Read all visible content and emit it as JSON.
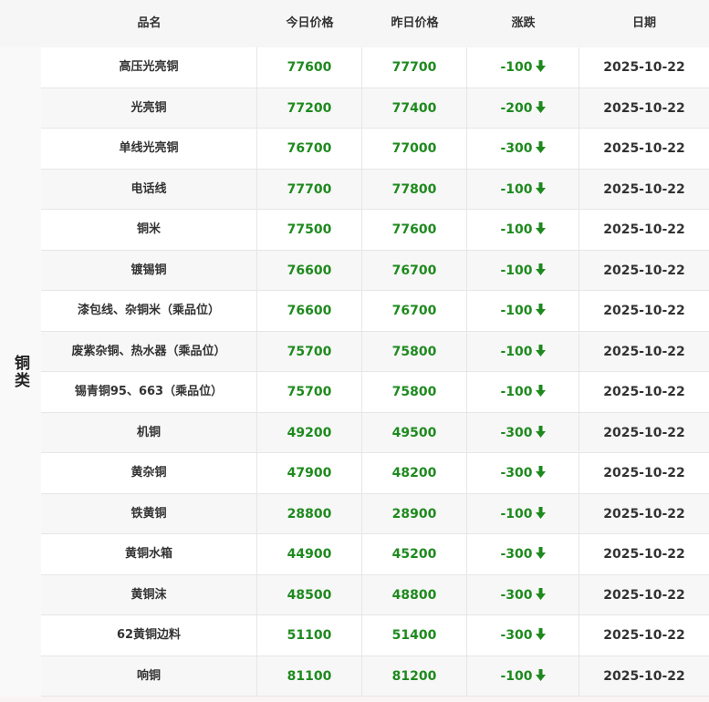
{
  "header": {
    "name": "品名",
    "today": "今日价格",
    "yesterday": "昨日价格",
    "change": "涨跌",
    "date": "日期"
  },
  "category": "铜类",
  "colors": {
    "green": "#1e8a1e"
  },
  "rows": [
    {
      "name": "高压光亮铜",
      "today": "77600",
      "yesterday": "77700",
      "change": "-100",
      "date": "2025-10-22"
    },
    {
      "name": "光亮铜",
      "today": "77200",
      "yesterday": "77400",
      "change": "-200",
      "date": "2025-10-22"
    },
    {
      "name": "单线光亮铜",
      "today": "76700",
      "yesterday": "77000",
      "change": "-300",
      "date": "2025-10-22"
    },
    {
      "name": "电话线",
      "today": "77700",
      "yesterday": "77800",
      "change": "-100",
      "date": "2025-10-22"
    },
    {
      "name": "铜米",
      "today": "77500",
      "yesterday": "77600",
      "change": "-100",
      "date": "2025-10-22"
    },
    {
      "name": "镀锡铜",
      "today": "76600",
      "yesterday": "76700",
      "change": "-100",
      "date": "2025-10-22"
    },
    {
      "name": "漆包线、杂铜米（乘品位）",
      "today": "76600",
      "yesterday": "76700",
      "change": "-100",
      "date": "2025-10-22"
    },
    {
      "name": "废紫杂铜、热水器（乘品位）",
      "today": "75700",
      "yesterday": "75800",
      "change": "-100",
      "date": "2025-10-22"
    },
    {
      "name": "锡青铜95、663（乘品位）",
      "today": "75700",
      "yesterday": "75800",
      "change": "-100",
      "date": "2025-10-22"
    },
    {
      "name": "机铜",
      "today": "49200",
      "yesterday": "49500",
      "change": "-300",
      "date": "2025-10-22"
    },
    {
      "name": "黄杂铜",
      "today": "47900",
      "yesterday": "48200",
      "change": "-300",
      "date": "2025-10-22"
    },
    {
      "name": "铁黄铜",
      "today": "28800",
      "yesterday": "28900",
      "change": "-100",
      "date": "2025-10-22"
    },
    {
      "name": "黄铜水箱",
      "today": "44900",
      "yesterday": "45200",
      "change": "-300",
      "date": "2025-10-22"
    },
    {
      "name": "黄铜沫",
      "today": "48500",
      "yesterday": "48800",
      "change": "-300",
      "date": "2025-10-22"
    },
    {
      "name": "62黄铜边料",
      "today": "51100",
      "yesterday": "51400",
      "change": "-300",
      "date": "2025-10-22"
    },
    {
      "name": "响铜",
      "today": "81100",
      "yesterday": "81200",
      "change": "-100",
      "date": "2025-10-22"
    }
  ]
}
